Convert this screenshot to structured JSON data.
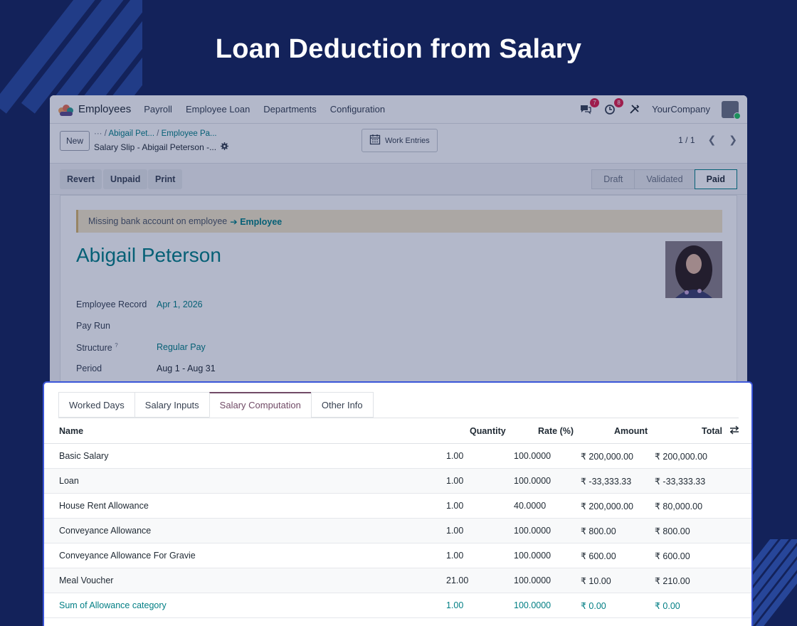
{
  "hero": {
    "title": "Loan Deduction from Salary"
  },
  "navbar": {
    "brand": "Employees",
    "items": [
      "Payroll",
      "Employee Loan",
      "Departments",
      "Configuration"
    ],
    "chat_badge": "7",
    "activity_badge": "8",
    "company": "YourCompany"
  },
  "control_panel": {
    "new_label": "New",
    "breadcrumb_root": "···",
    "breadcrumb_1": "Abigail Pet...",
    "breadcrumb_2": "Employee Pa...",
    "record_title": "Salary Slip - Abigail Peterson -...",
    "work_entries_label": "Work Entries",
    "pager": "1 / 1"
  },
  "status": {
    "actions": [
      "Revert",
      "Unpaid",
      "Print"
    ],
    "stages": [
      "Draft",
      "Validated",
      "Paid"
    ],
    "active_stage": "Paid"
  },
  "sheet": {
    "alert_text": "Missing bank account on employee",
    "alert_link": "➔ Employee",
    "employee_name": "Abigail Peterson",
    "fields": {
      "employee_record_label": "Employee Record",
      "employee_record_value": "Apr 1, 2026",
      "pay_run_label": "Pay Run",
      "structure_label": "Structure",
      "structure_help": "?",
      "structure_value": "Regular Pay",
      "period_label": "Period",
      "period_value": "Aug 1 - Aug 31"
    }
  },
  "computation": {
    "tabs": [
      "Worked Days",
      "Salary Inputs",
      "Salary Computation",
      "Other Info"
    ],
    "active_tab": "Salary Computation",
    "headers": {
      "name": "Name",
      "quantity": "Quantity",
      "rate": "Rate (%)",
      "amount": "Amount",
      "total": "Total"
    },
    "rows": [
      {
        "name": "Basic Salary",
        "quantity": "1.00",
        "rate": "100.0000",
        "amount": "₹ 200,000.00",
        "total": "₹ 200,000.00"
      },
      {
        "name": "Loan",
        "quantity": "1.00",
        "rate": "100.0000",
        "amount": "₹ -33,333.33",
        "total": "₹ -33,333.33"
      },
      {
        "name": "House Rent Allowance",
        "quantity": "1.00",
        "rate": "40.0000",
        "amount": "₹ 200,000.00",
        "total": "₹ 80,000.00"
      },
      {
        "name": "Conveyance Allowance",
        "quantity": "1.00",
        "rate": "100.0000",
        "amount": "₹ 800.00",
        "total": "₹ 800.00"
      },
      {
        "name": "Conveyance Allowance For Gravie",
        "quantity": "1.00",
        "rate": "100.0000",
        "amount": "₹ 600.00",
        "total": "₹ 600.00"
      },
      {
        "name": "Meal Voucher",
        "quantity": "21.00",
        "rate": "100.0000",
        "amount": "₹ 10.00",
        "total": "₹ 210.00"
      },
      {
        "name": "Sum of Allowance category",
        "quantity": "1.00",
        "rate": "100.0000",
        "amount": "₹ 0.00",
        "total": "₹ 0.00"
      }
    ]
  },
  "colors": {
    "background": "#13225a",
    "accent": "#017e84",
    "highlight_border": "#3b56d9",
    "tab_active": "#714b67"
  }
}
